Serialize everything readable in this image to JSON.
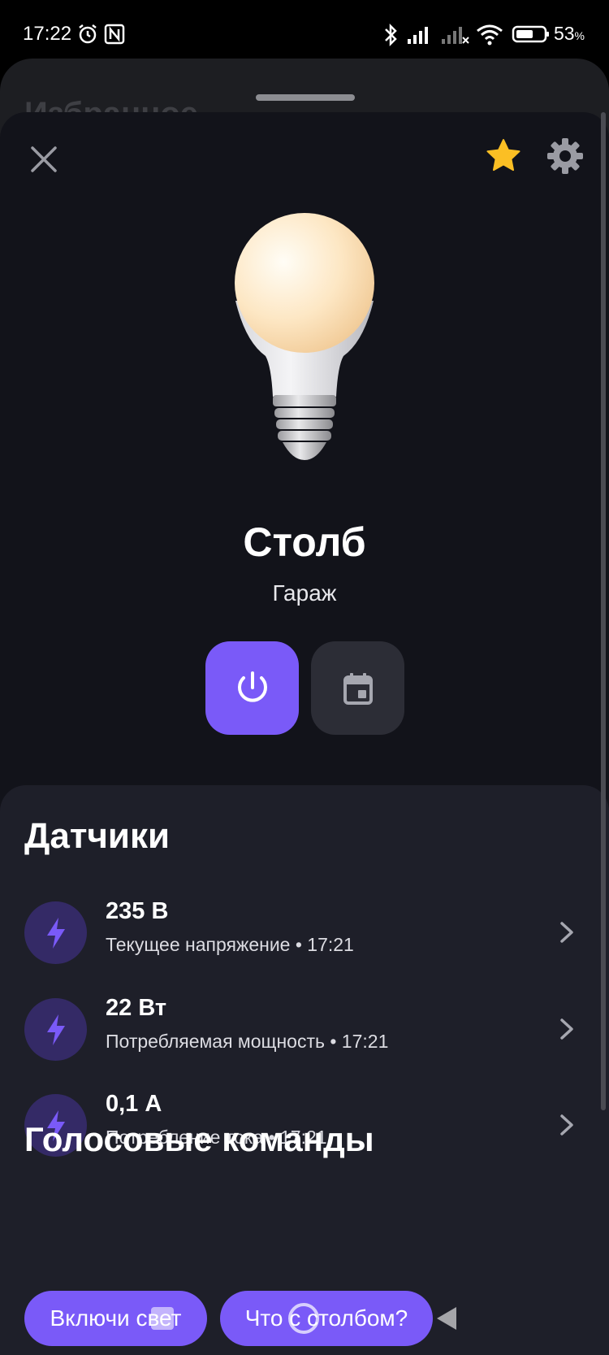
{
  "status_bar": {
    "time": "17:22",
    "battery_percent": "53",
    "battery_unit": "%",
    "icons": [
      "alarm-icon",
      "nfc-icon",
      "bluetooth-icon",
      "signal-icon",
      "signal-no-service-icon",
      "wifi-icon",
      "battery-icon"
    ]
  },
  "background": {
    "title": "Избранное"
  },
  "device": {
    "name": "Столб",
    "room": "Гараж",
    "favorite": true,
    "power_on": true
  },
  "sensors": {
    "title": "Датчики",
    "items": [
      {
        "value": "235 В",
        "label": "Текущее напряжение • 17:21"
      },
      {
        "value": "22 Вт",
        "label": "Потребляемая мощность • 17:21"
      },
      {
        "value": "0,1 А",
        "label": "Потребление тока • 17:21"
      }
    ]
  },
  "voice": {
    "title": "Голосовые команды",
    "commands": [
      "Включи свет",
      "Что с столбом?"
    ]
  },
  "colors": {
    "accent": "#7a5af8",
    "star": "#fbbf24",
    "sheet": "#12131a",
    "panel": "#1e1f29"
  }
}
